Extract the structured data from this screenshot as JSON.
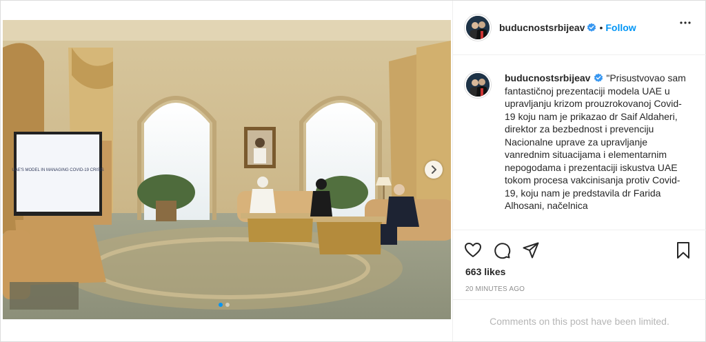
{
  "post": {
    "username": "buducnostsrbijeav",
    "follow_label": "Follow",
    "separator": "•",
    "caption": "\"Prisustvovao sam fantastičnoj prezentaciji modela UAE u upravljanju krizom prouzrokovanoj Covid-19 koju nam je prikazao dr Saif Aldaheri, direktor za bezbednost i prevenciju Nacionalne uprave za upravljanje vanrednim situacijama i elementarnim nepogodama i prezentaciji iskustva UAE tokom procesa vakcinisanja protiv Covid-19, koju nam je predstavila dr Farida Alhosani, načelnica",
    "likes": "663 likes",
    "time_ago": "20 MINUTES AGO",
    "comments_limited": "Comments on this post have been limited."
  },
  "photo": {
    "tv_screen_text": "UAE'S MODEL IN MANAGING COVID-19 CRISIS",
    "carousel_count": 2,
    "carousel_active": 0
  },
  "icons": [
    "verified-badge-icon",
    "more-options-icon",
    "heart-icon",
    "comment-icon",
    "share-icon",
    "bookmark-icon",
    "chevron-right-icon"
  ],
  "colors": {
    "accent": "#0095f6",
    "text": "#262626",
    "muted": "#8e8e8e",
    "border": "#dbdbdb"
  }
}
